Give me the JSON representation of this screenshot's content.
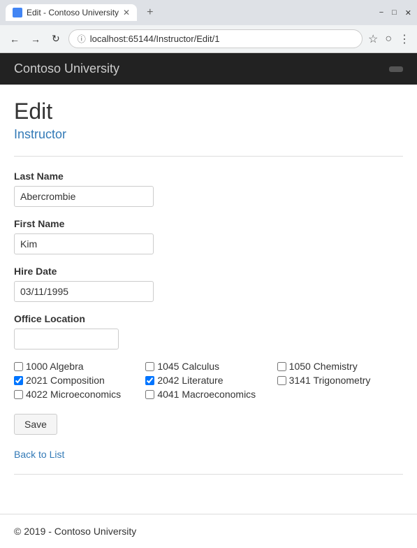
{
  "browser": {
    "tab_title": "Edit - Contoso University",
    "new_tab_label": "+",
    "address": "localhost:65144/Instructor/Edit/1",
    "window_controls": {
      "minimize": "−",
      "maximize": "□",
      "close": "✕"
    },
    "nav": {
      "back": "←",
      "forward": "→",
      "reload": "↻"
    }
  },
  "header": {
    "title": "Contoso University",
    "button_label": ""
  },
  "page": {
    "heading": "Edit",
    "subheading": "Instructor",
    "fields": {
      "last_name": {
        "label": "Last Name",
        "value": "Abercrombie",
        "placeholder": ""
      },
      "first_name": {
        "label": "First Name",
        "value": "Kim",
        "placeholder": ""
      },
      "hire_date": {
        "label": "Hire Date",
        "value": "03/11/1995",
        "placeholder": ""
      },
      "office_location": {
        "label": "Office Location",
        "value": "",
        "placeholder": ""
      }
    },
    "courses": [
      {
        "id": "1000",
        "label": "1000 Algebra",
        "checked": false
      },
      {
        "id": "1045",
        "label": "1045 Calculus",
        "checked": false
      },
      {
        "id": "1050",
        "label": "1050 Chemistry",
        "checked": false
      },
      {
        "id": "2021",
        "label": "2021 Composition",
        "checked": true
      },
      {
        "id": "2042",
        "label": "2042 Literature",
        "checked": true
      },
      {
        "id": "3141",
        "label": "3141 Trigonometry",
        "checked": false
      },
      {
        "id": "4022",
        "label": "4022 Microeconomics",
        "checked": false
      },
      {
        "id": "4041",
        "label": "4041 Macroeconomics",
        "checked": false
      }
    ],
    "save_button": "Save",
    "back_link": "Back to List",
    "footer": "© 2019 - Contoso University"
  }
}
